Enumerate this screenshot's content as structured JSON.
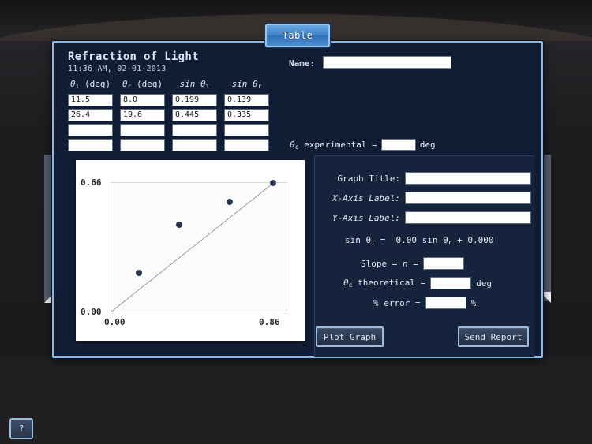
{
  "tab": {
    "label": "Table"
  },
  "window": {
    "title": "Refraction of Light",
    "timestamp": "11:36 AM, 02-01-2013",
    "name_label": "Name:",
    "name_value": ""
  },
  "table": {
    "columns": [
      {
        "head_main": "θ",
        "head_sub": "i",
        "head_unit": " (deg)"
      },
      {
        "head_main": "θ",
        "head_sub": "r",
        "head_unit": " (deg)"
      },
      {
        "head_main": "sin θ",
        "head_sub": "i",
        "head_unit": ""
      },
      {
        "head_main": "sin θ",
        "head_sub": "r",
        "head_unit": ""
      }
    ],
    "rows": [
      [
        "11.5",
        "8.0",
        "0.199",
        "0.139"
      ],
      [
        "26.4",
        "19.6",
        "0.445",
        "0.335"
      ],
      [
        "",
        "",
        "",
        ""
      ],
      [
        "",
        "",
        "",
        ""
      ]
    ]
  },
  "theta_c_experimental": {
    "label_main": "θ",
    "label_sub": "c",
    "label_rest": " experimental =",
    "value": "",
    "unit": "deg"
  },
  "right_panel": {
    "graph_title_label": "Graph Title:",
    "graph_title_value": "",
    "x_axis_label": "X-Axis Label:",
    "x_axis_value": "",
    "y_axis_label": "Y-Axis Label:",
    "y_axis_value": "",
    "equation": {
      "lhs_main": "sin θ",
      "lhs_sub": "i",
      "eq": "=",
      "slope": "0.00",
      "mid_main": "sin  θ",
      "mid_sub": "r",
      "plus": "+",
      "intercept": "0.000"
    },
    "slope_label": "Slope = ",
    "slope_symbol": "n",
    "slope_eq": " =",
    "slope_value": "",
    "theta_theo_main": "θ",
    "theta_theo_sub": "c",
    "theta_theo_rest": " theoretical =",
    "theta_theo_value": "",
    "theta_theo_unit": "deg",
    "percent_error_label": "% error =",
    "percent_error_value": "",
    "percent_error_unit": "%"
  },
  "buttons": {
    "plot_graph": "Plot Graph",
    "send_report": "Send Report",
    "help": "?"
  },
  "chart_data": {
    "type": "scatter",
    "title": "",
    "xlabel": "",
    "ylabel": "",
    "xlim": [
      0.0,
      0.86
    ],
    "ylim": [
      0.0,
      0.66
    ],
    "xticks": [
      "0.00",
      "0.86"
    ],
    "yticks": [
      "0.00",
      "0.66"
    ],
    "grid": false,
    "legend": "none",
    "point_color": "#2a3650",
    "line_color": "#9a9aa0",
    "x": [
      0.139,
      0.335,
      0.58,
      0.79
    ],
    "y": [
      0.199,
      0.445,
      0.56,
      0.655
    ],
    "fit_line": {
      "slope": 0.0,
      "intercept": 0.0,
      "visible": true
    }
  }
}
